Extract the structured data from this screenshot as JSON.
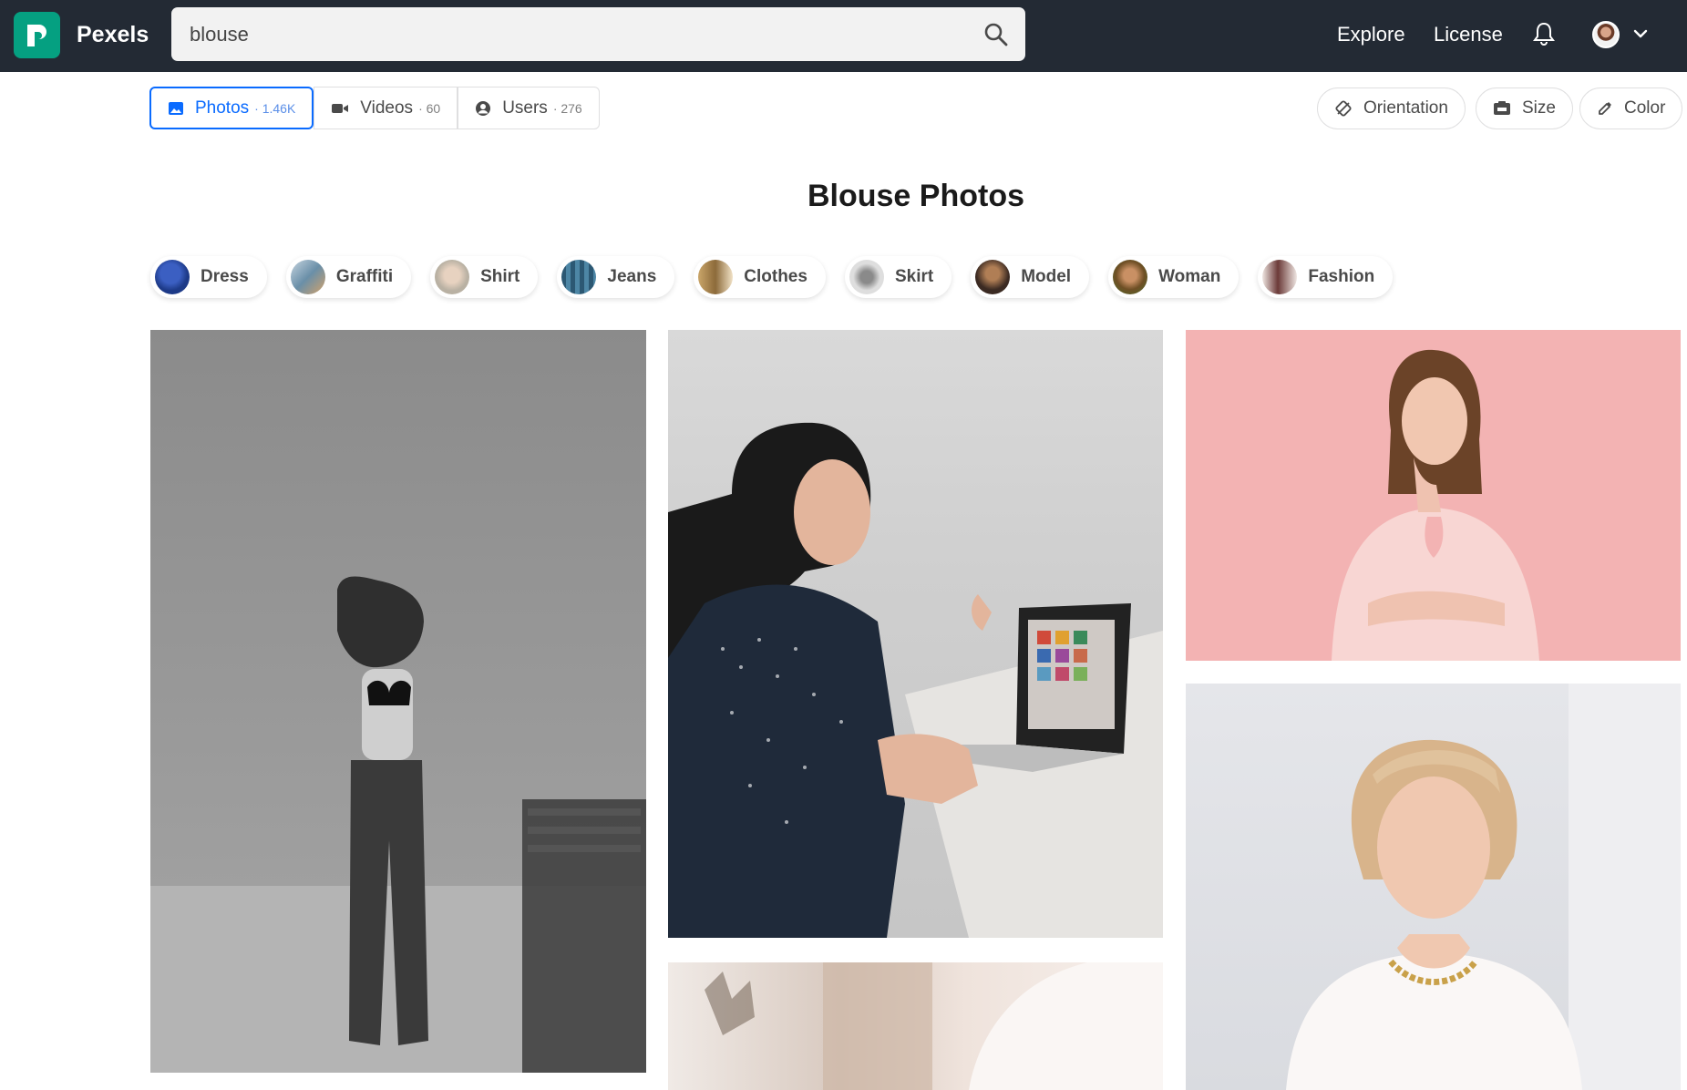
{
  "header": {
    "brand": "Pexels",
    "search_value": "blouse",
    "nav": [
      "Explore",
      "License"
    ]
  },
  "tabs": [
    {
      "label": "Photos",
      "count": "· 1.46K",
      "active": true
    },
    {
      "label": "Videos",
      "count": "· 60",
      "active": false
    },
    {
      "label": "Users",
      "count": "· 276",
      "active": false
    }
  ],
  "filters": [
    "Orientation",
    "Size",
    "Color"
  ],
  "title": "Blouse Photos",
  "related": [
    {
      "label": "Dress",
      "color": "#1d3a88"
    },
    {
      "label": "Graffiti",
      "color": "#6a8fa8"
    },
    {
      "label": "Shirt",
      "color": "#b9b1a3"
    },
    {
      "label": "Jeans",
      "color": "#3a6b86"
    },
    {
      "label": "Clothes",
      "color": "#8c6a3a"
    },
    {
      "label": "Skirt",
      "color": "#c8c8c8"
    },
    {
      "label": "Model",
      "color": "#5a4030"
    },
    {
      "label": "Woman",
      "color": "#6f4f25"
    },
    {
      "label": "Fashion",
      "color": "#9a7f79"
    }
  ],
  "colors": {
    "header_bg": "#232a34",
    "brand_green": "#05a081",
    "accent_blue": "#0a6bff"
  }
}
